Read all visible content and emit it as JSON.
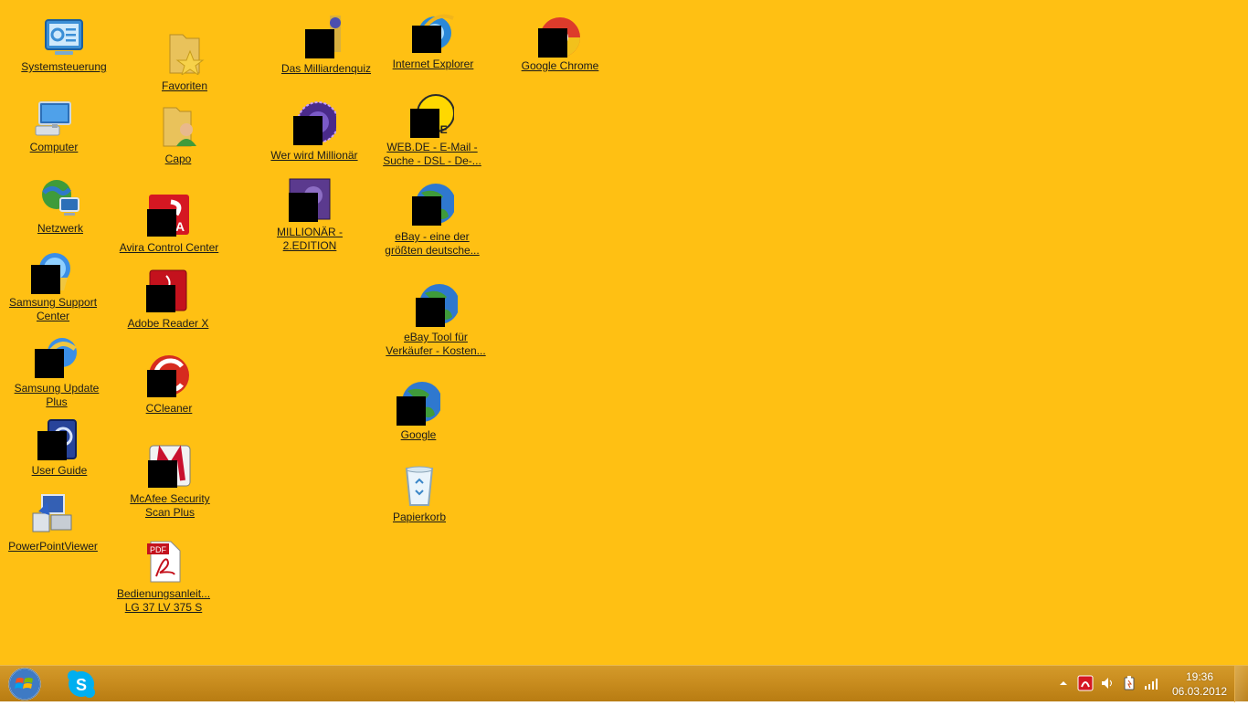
{
  "desktop": {
    "background_color": "#ffc013",
    "icons": {
      "systemsteuerung": {
        "label": "Systemsteuerung",
        "icon": "control-panel-icon"
      },
      "computer": {
        "label": "Computer",
        "icon": "computer-icon"
      },
      "netzwerk": {
        "label": "Netzwerk",
        "icon": "network-icon"
      },
      "samsung_support": {
        "label": "Samsung Support\nCenter",
        "icon": "samsung-support-icon"
      },
      "samsung_update": {
        "label": "Samsung Update\nPlus",
        "icon": "samsung-update-icon"
      },
      "user_guide": {
        "label": "User Guide",
        "icon": "user-guide-icon"
      },
      "powerpoint_viewer": {
        "label": "PowerPointViewer",
        "icon": "powerpoint-viewer-icon"
      },
      "favoriten": {
        "label": "Favoriten",
        "icon": "favorites-folder-icon"
      },
      "capo": {
        "label": "Capo",
        "icon": "user-folder-icon"
      },
      "avira": {
        "label": "Avira Control Center",
        "icon": "avira-icon"
      },
      "adobe_reader": {
        "label": "Adobe Reader X",
        "icon": "adobe-reader-icon"
      },
      "ccleaner": {
        "label": "CCleaner",
        "icon": "ccleaner-icon"
      },
      "mcafee": {
        "label": "McAfee Security\nScan Plus",
        "icon": "mcafee-icon"
      },
      "bedienungsanleitung": {
        "label": "Bedienungsanleit...\nLG 37 LV 375 S",
        "icon": "pdf-file-icon"
      },
      "milliardenquiz": {
        "label": "Das Milliardenquiz",
        "icon": "quiz-game-icon"
      },
      "wer_wird_millionaer": {
        "label": "Wer wird Millionär",
        "icon": "millionaire-game-icon"
      },
      "millionaer_2": {
        "label": "MILLIONÄR -\n2.EDITION",
        "icon": "millionaire-edition-icon"
      },
      "internet_explorer": {
        "label": "Internet Explorer",
        "icon": "internet-explorer-icon"
      },
      "webde": {
        "label": "WEB.DE - E-Mail -\nSuche - DSL - De-...",
        "icon": "webde-icon"
      },
      "ebay": {
        "label": "eBay - eine der\ngrößten deutsche...",
        "icon": "globe-shortcut-icon"
      },
      "ebay_tool": {
        "label": "eBay Tool für\nVerkäufer - Kosten...",
        "icon": "globe-shortcut-icon"
      },
      "google": {
        "label": "Google",
        "icon": "globe-shortcut-icon"
      },
      "papierkorb": {
        "label": "Papierkorb",
        "icon": "recycle-bin-icon"
      },
      "google_chrome": {
        "label": "Google Chrome",
        "icon": "chrome-icon"
      }
    }
  },
  "taskbar": {
    "start": {
      "icon": "windows-orb-icon"
    },
    "pinned": [
      {
        "icon": "skype-icon"
      }
    ],
    "tray": {
      "icons": [
        "show-hidden-icons-arrow",
        "avira-tray-icon",
        "volume-icon",
        "power-icon",
        "signal-icon"
      ]
    },
    "clock": {
      "time": "19:36",
      "date": "06.03.2012"
    }
  }
}
